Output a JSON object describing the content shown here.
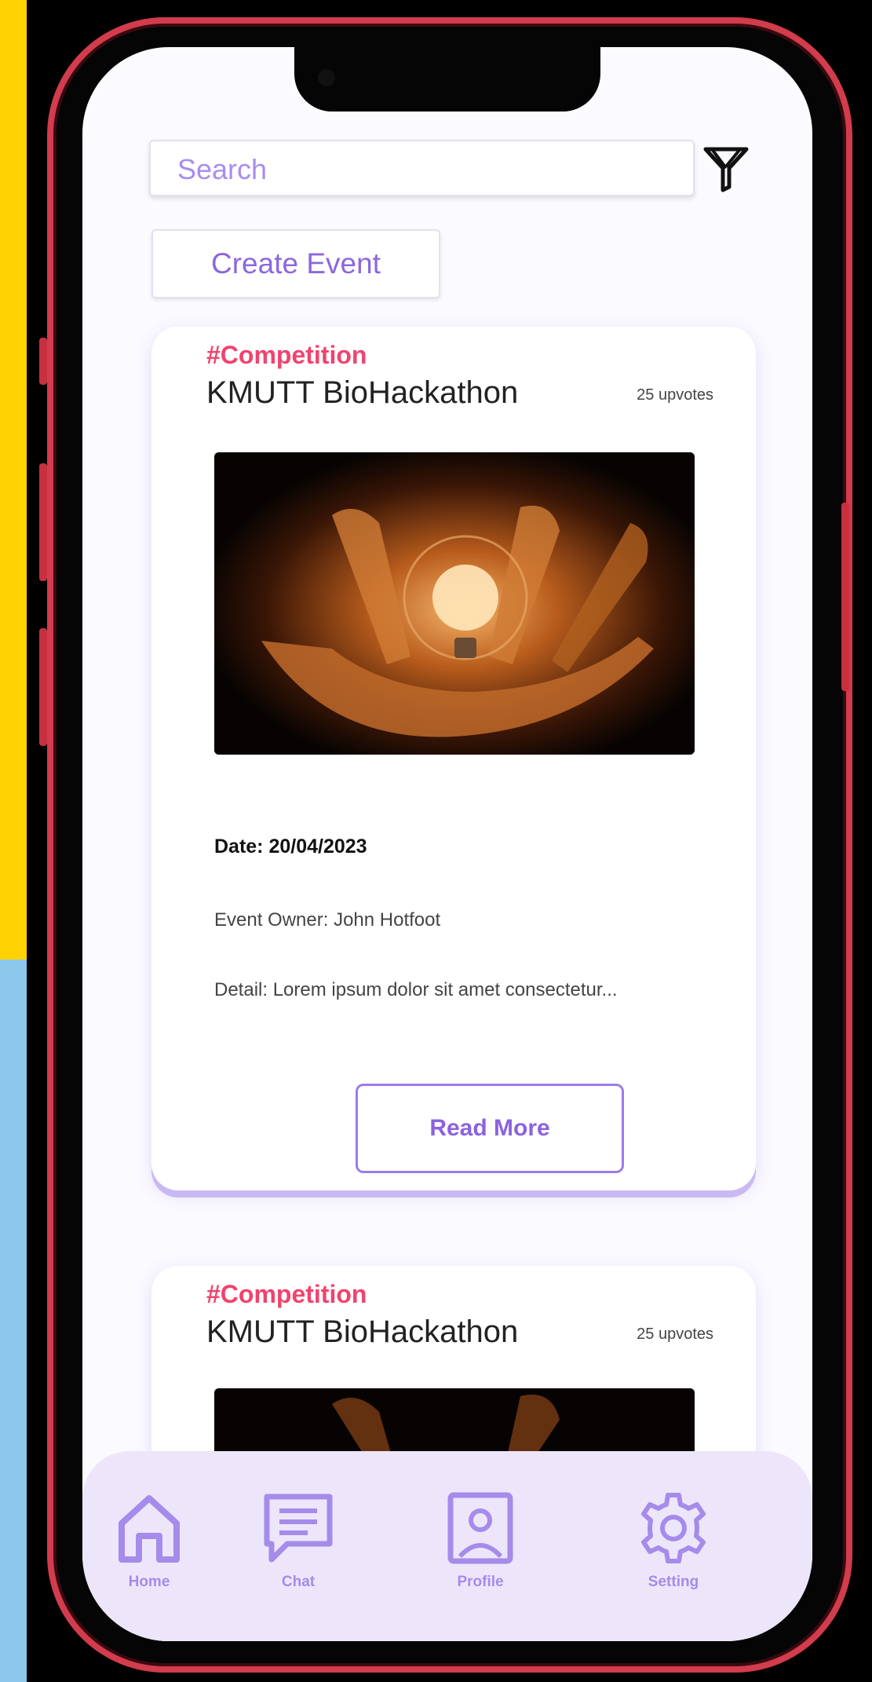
{
  "search": {
    "placeholder": "Search"
  },
  "create_event_label": "Create Event",
  "cards": [
    {
      "tag": "#Competition",
      "title": "KMUTT BioHackathon",
      "upvotes": "25 upvotes",
      "date": "Date: 20/04/2023",
      "owner": "Event Owner: John Hotfoot",
      "detail": "Detail: Lorem ipsum dolor sit amet consectetur...",
      "read_more": "Read More"
    },
    {
      "tag": "#Competition",
      "title": "KMUTT BioHackathon",
      "upvotes": "25 upvotes"
    }
  ],
  "nav": [
    {
      "label": "Home",
      "icon": "home-icon"
    },
    {
      "label": "Chat",
      "icon": "chat-icon"
    },
    {
      "label": "Profile",
      "icon": "profile-icon"
    },
    {
      "label": "Setting",
      "icon": "gear-icon"
    }
  ],
  "colors": {
    "accent": "#8B67E0",
    "tag": "#F0436E",
    "frame": "#D23C4C",
    "nav_bg": "#EDE6FB"
  }
}
